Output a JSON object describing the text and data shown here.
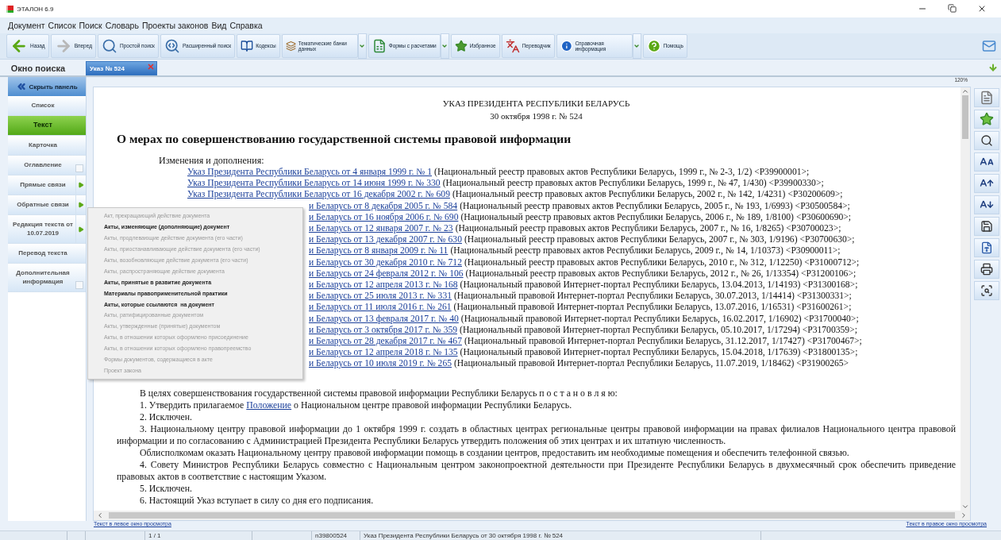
{
  "window": {
    "title": "ЭТАЛОН 6.9"
  },
  "menu": [
    "Документ",
    "Список",
    "Поиск",
    "Словарь",
    "Проекты законов",
    "Вид",
    "Справка"
  ],
  "toolbar": [
    {
      "label": "Назад",
      "dropdown": false
    },
    {
      "label": "Вперед",
      "dropdown": false
    },
    {
      "label": "Простой поиск",
      "dropdown": false
    },
    {
      "label": "Расширенный поиск",
      "dropdown": false
    },
    {
      "label": "Кодексы",
      "dropdown": false
    },
    {
      "label": "Тематические банки данных",
      "dropdown": true
    },
    {
      "label": "Формы с расчетами",
      "dropdown": true
    },
    {
      "label": "Избранное",
      "dropdown": false
    },
    {
      "label": "Переводчик",
      "dropdown": false
    },
    {
      "label": "Справочная информация",
      "dropdown": true
    },
    {
      "label": "Помощь",
      "dropdown": false
    }
  ],
  "tabs": [
    {
      "label": "Окно поиска",
      "selected": false,
      "closable": false
    },
    {
      "label": "Указ № 524",
      "selected": true,
      "closable": true
    }
  ],
  "side_panel": {
    "hide_label": "Скрыть панель",
    "items": [
      {
        "label": "Список",
        "kind": "plain",
        "selected": false
      },
      {
        "label": "Текст",
        "kind": "plain",
        "selected": true
      },
      {
        "label": "Карточка",
        "kind": "plain",
        "selected": false
      },
      {
        "label": "Оглавление",
        "kind": "checkbox",
        "selected": false,
        "checked": false
      },
      {
        "label": "Прямые связи",
        "kind": "arrow",
        "selected": false
      },
      {
        "label": "Обратные связи",
        "kind": "arrow",
        "selected": false
      },
      {
        "label": "Редакция текста от 10.07.2019",
        "kind": "arrow",
        "selected": false
      },
      {
        "label": "Перевод текста",
        "kind": "plain",
        "selected": false
      },
      {
        "label": "Дополнительная информация",
        "kind": "checkbox",
        "selected": false,
        "checked": false
      }
    ]
  },
  "zoom": "120%",
  "document": {
    "header": "УКАЗ ПРЕЗИДЕНТА РЕСПУБЛИКИ БЕЛАРУСЬ",
    "date": "30 октября 1998 г. № 524",
    "title": "О мерах по совершенствованию государственной системы правовой информации",
    "amendments_label": "Изменения и дополнения:",
    "amendments": [
      {
        "kind": "full",
        "link": "Указ Президента Республики Беларусь от 4 января 1999 г. № 1",
        "source": "(Национальный реестр правовых актов Республики Беларусь, 1999 г., № 2-3, 1/2) <P39900001>;"
      },
      {
        "kind": "full",
        "link": "Указ Президента Республики Беларусь от 14 июня 1999 г. № 330",
        "source": "(Национальный реестр правовых актов Республики Беларусь, 1999 г., № 47, 1/430) <P39900330>;"
      },
      {
        "kind": "full",
        "link": "Указ Президента Республики Беларусь от 16 декабря 2002 г. № 609",
        "source": "(Национальный реестр правовых актов Республики Беларусь, 2002 г., № 142, 1/4231) <P30200609>;"
      },
      {
        "kind": "cut",
        "link": "и Беларусь от 8 декабря 2005 г. № 584",
        "source": "(Национальный реестр правовых актов Республики Беларусь, 2005 г., № 193, 1/6993) <P30500584>;"
      },
      {
        "kind": "cut",
        "link": "и Беларусь от 16 ноября 2006 г. № 690",
        "source": "(Национальный реестр правовых актов Республики Беларусь, 2006 г., № 189, 1/8100) <P30600690>;"
      },
      {
        "kind": "cut",
        "link": "и Беларусь от 12 января 2007 г. № 23",
        "source": "(Национальный реестр правовых актов Республики Беларусь, 2007 г., № 16, 1/8265) <P30700023>;"
      },
      {
        "kind": "cut",
        "link": "и Беларусь от 13 декабря 2007 г. № 630",
        "source": "(Национальный реестр правовых актов Республики Беларусь, 2007 г., № 303, 1/9196) <P30700630>;"
      },
      {
        "kind": "cut",
        "link": "и Беларусь от 8 января 2009 г. № 11",
        "source": "(Национальный реестр правовых актов Республики Беларусь, 2009 г., № 14, 1/10373) <P30900011>;"
      },
      {
        "kind": "cut",
        "link": "и Беларусь от 30 декабря 2010 г. № 712",
        "source": "(Национальный реестр правовых актов Республики Беларусь, 2010 г., № 312, 1/12250) <P31000712>;"
      },
      {
        "kind": "cut",
        "link": "и Беларусь от 24 февраля 2012 г. № 106",
        "source": "(Национальный реестр правовых актов Республики Беларусь, 2012 г., № 26, 1/13354) <P31200106>;"
      },
      {
        "kind": "cut",
        "link": "и Беларусь от 12 апреля 2013 г. № 168",
        "source": "(Национальный правовой Интернет-портал Республики Беларусь, 13.04.2013, 1/14193) <P31300168>;"
      },
      {
        "kind": "cut",
        "link": "и Беларусь от 25 июля 2013 г. № 331",
        "source": "(Национальный правовой Интернет-портал Республики Беларусь, 30.07.2013, 1/14414) <P31300331>;"
      },
      {
        "kind": "cut",
        "link": "и Беларусь от 11 июля 2016 г. № 261",
        "source": "(Национальный правовой Интернет-портал Республики Беларусь, 13.07.2016, 1/16531) <P31600261>;"
      },
      {
        "kind": "cut",
        "link": "и Беларусь от 13 февраля 2017 г. № 40",
        "source": "(Национальный правовой Интернет-портал Республики Беларусь, 16.02.2017, 1/16902) <P31700040>;"
      },
      {
        "kind": "cut",
        "link": "и Беларусь от 3 октября 2017 г. № 359",
        "source": "(Национальный правовой Интернет-портал Республики Беларусь, 05.10.2017, 1/17294) <P31700359>;"
      },
      {
        "kind": "cut",
        "link": "и Беларусь от 28 декабря 2017 г. № 467",
        "source": "(Национальный правовой Интернет-портал Республики Беларусь, 31.12.2017, 1/17427) <P31700467>;"
      },
      {
        "kind": "cut",
        "link": "и Беларусь от 12 апреля 2018 г. № 135",
        "source": "(Национальный правовой Интернет-портал Республики Беларусь, 15.04.2018, 1/17639) <P31800135>;"
      },
      {
        "kind": "cut",
        "link": "и Беларусь от 10 июля 2019 г. № 265",
        "source": "(Национальный правовой Интернет-портал Республики Беларусь, 11.07.2019, 1/18462) <P31900265>"
      }
    ],
    "paragraphs": [
      {
        "text": "В целях совершенствования государственной системы правовой информации Республики Беларусь п о с т а н о в л я ю:"
      },
      {
        "text": "1. Утвердить прилагаемое",
        "link": "Положение",
        "after": "о Национальном центре правовой информации Республики Беларусь."
      },
      {
        "text": "2. Исключен."
      },
      {
        "text": "3. Национальному центру правовой информации до 1 октября 1999 г. создать в областных центрах региональные центры правовой информации на правах филиалов Национального центра правовой информации и по согласованию с Администрацией Президента Республики Беларусь утвердить положения об этих центрах и их штатную численность."
      },
      {
        "text": "Облисполкомам оказать Национальному центру правовой информации помощь в создании центров, предоставить им необходимые помещения и обеспечить телефонной связью."
      },
      {
        "text": "4. Совету Министров Республики Беларусь совместно с Национальным центром законопроектной деятельности при Президенте Республики Беларусь в двухмесячный срок обеспечить приведение правовых актов в соответствие с настоящим Указом."
      },
      {
        "text": "5. Исключен."
      },
      {
        "text": "6. Настоящий Указ вступает в силу со дня его подписания."
      }
    ]
  },
  "popup_menu": [
    {
      "label": "Акт, прекращающий действие документа",
      "disabled": true
    },
    {
      "label": "Акты, изменяющие (дополняющие) документ",
      "disabled": false
    },
    {
      "label": "Акты, продлевающие действие документа (его части)",
      "disabled": true
    },
    {
      "label": "Акты, приостанавливающие действие документа (его части)",
      "disabled": true
    },
    {
      "label": "Акты, возобновляющие действие документа (его части)",
      "disabled": true
    },
    {
      "label": "Акты, распространяющие действие документа",
      "disabled": true
    },
    {
      "label": "Акты, принятые в развитие документа",
      "disabled": false
    },
    {
      "label": "Материалы правоприменительной практики",
      "disabled": false
    },
    {
      "label": "Акты, которые ссылаются  на документ",
      "disabled": false
    },
    {
      "label": "Акты, ратифицированные документом",
      "disabled": true
    },
    {
      "label": "Акты, утвержденные (принятые) документом",
      "disabled": true
    },
    {
      "label": "Акты, в отношении которых оформлено присоединение",
      "disabled": true
    },
    {
      "label": "Акты, в отношении которых оформлено правопреемство",
      "disabled": true
    },
    {
      "label": "Формы документов, содержащиеся в акте",
      "disabled": true
    },
    {
      "label": "Проект закона",
      "disabled": true
    }
  ],
  "bottom_links": {
    "left": "Текст в левое окно просмотра",
    "right": "Текст в правое окно просмотра"
  },
  "status_bar": {
    "page": "1 / 1",
    "code": "n39800524",
    "doc_title": "Указ Президента Республики Беларусь от 30 октября 1998 г. № 524"
  }
}
